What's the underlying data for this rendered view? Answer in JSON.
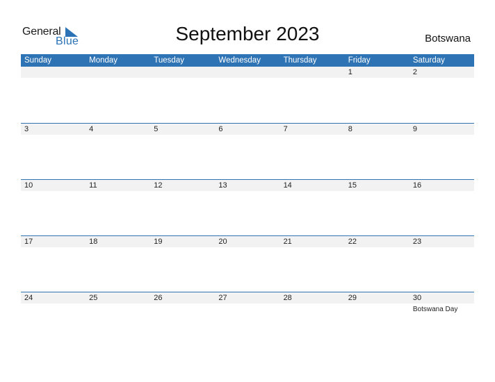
{
  "logo": {
    "line1": "General",
    "line2": "Blue",
    "icon": "triangle-flag-icon",
    "accent": "#2b73b6"
  },
  "title": "September 2023",
  "country": "Botswana",
  "header_color": "#2e73b4",
  "weekdays": [
    "Sunday",
    "Monday",
    "Tuesday",
    "Wednesday",
    "Thursday",
    "Friday",
    "Saturday"
  ],
  "weeks": [
    [
      "",
      "",
      "",
      "",
      "",
      "1",
      "2"
    ],
    [
      "3",
      "4",
      "5",
      "6",
      "7",
      "8",
      "9"
    ],
    [
      "10",
      "11",
      "12",
      "13",
      "14",
      "15",
      "16"
    ],
    [
      "17",
      "18",
      "19",
      "20",
      "21",
      "22",
      "23"
    ],
    [
      "24",
      "25",
      "26",
      "27",
      "28",
      "29",
      "30"
    ]
  ],
  "holidays": [
    {
      "date": "30",
      "name": "Botswana Day"
    }
  ]
}
